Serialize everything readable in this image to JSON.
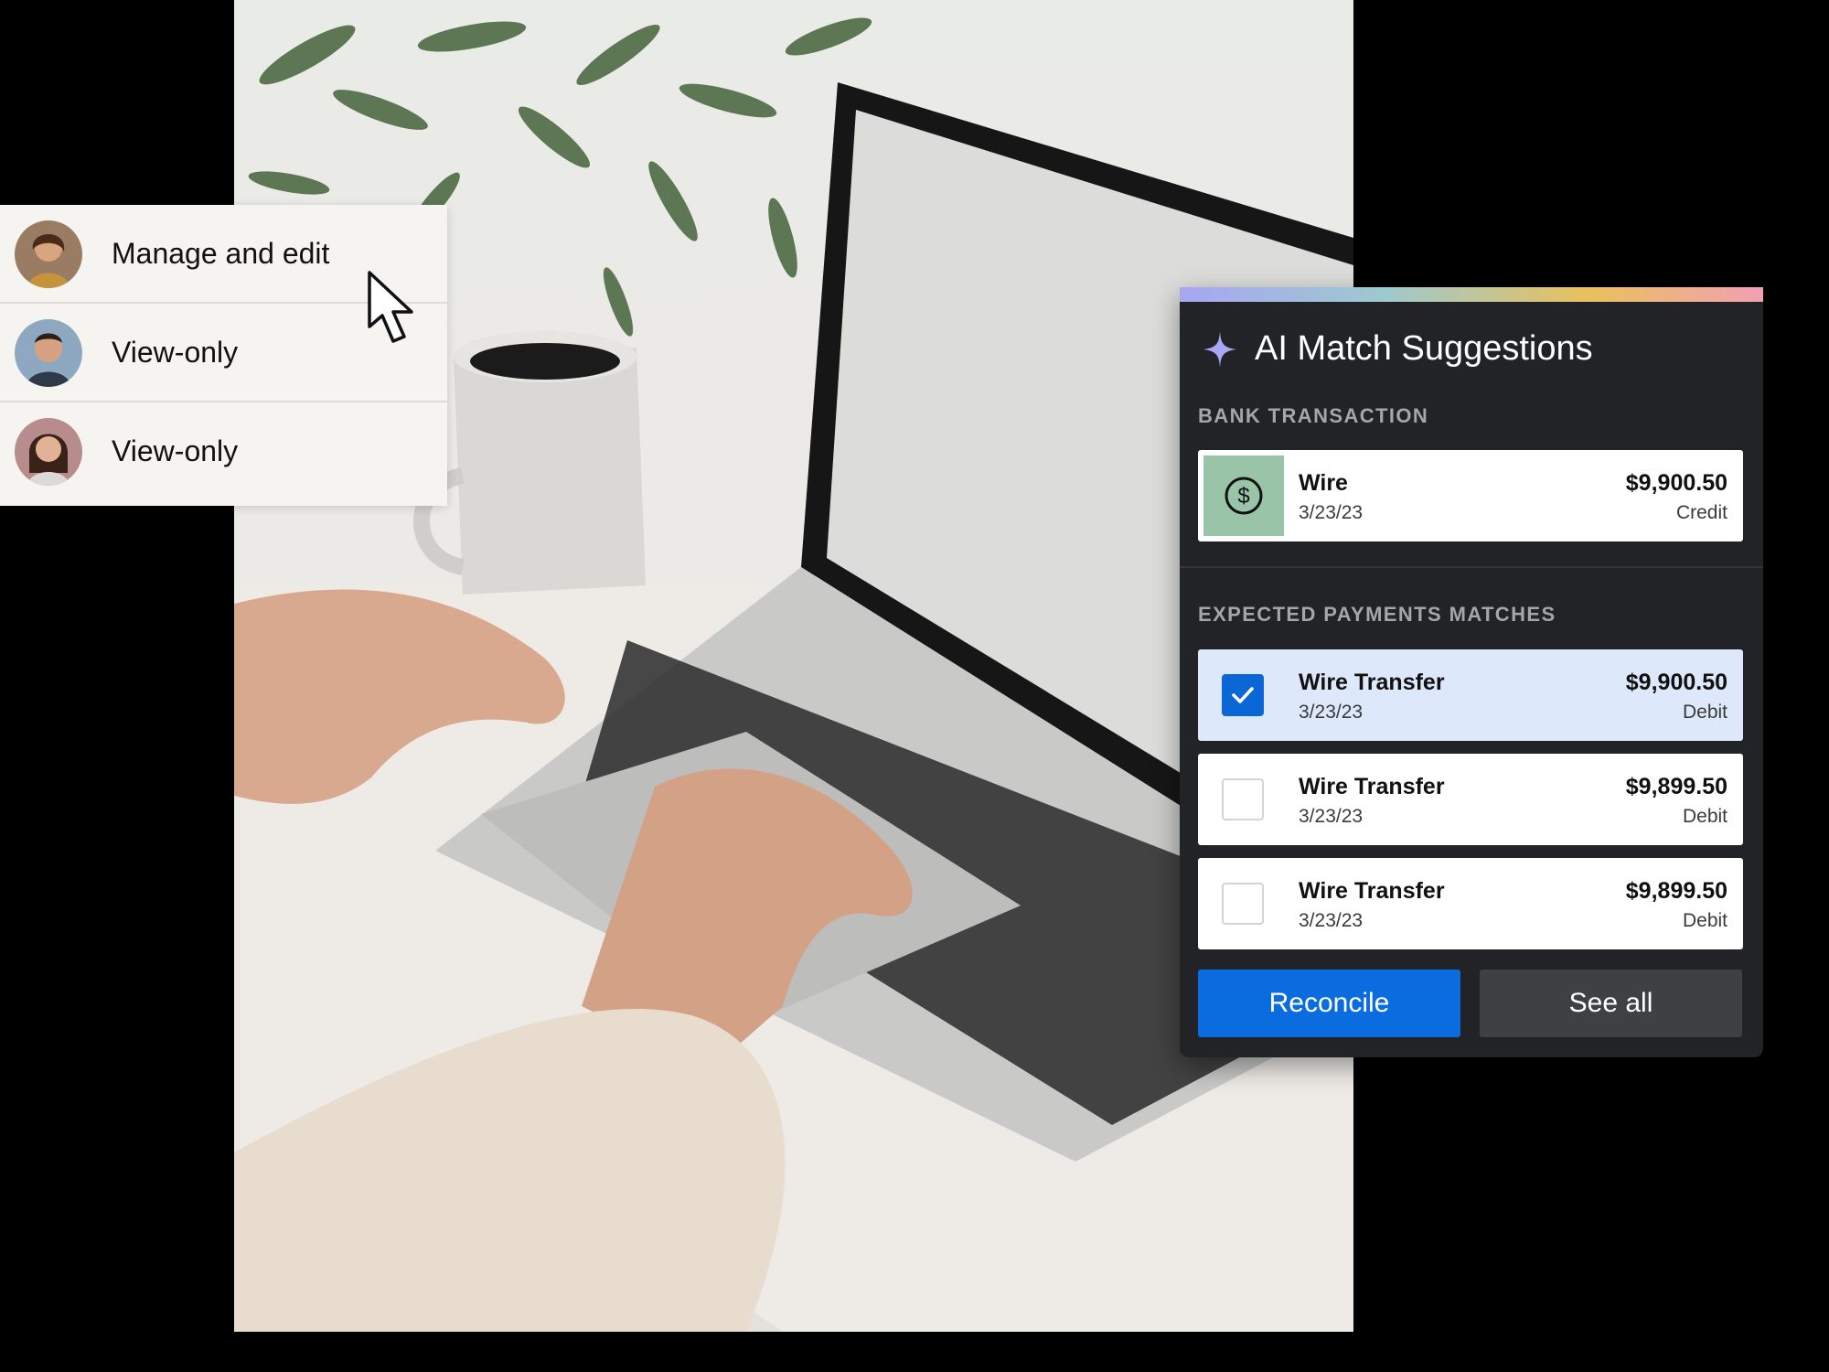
{
  "permissions": {
    "rows": [
      {
        "label": "Manage and edit"
      },
      {
        "label": "View-only"
      },
      {
        "label": "View-only"
      }
    ]
  },
  "ai_panel": {
    "title": "AI Match Suggestions",
    "bank_section_label": "BANK TRANSACTION",
    "bank_transaction": {
      "name": "Wire",
      "date": "3/23/23",
      "amount": "$9,900.50",
      "type": "Credit"
    },
    "matches_section_label": "EXPECTED PAYMENTS MATCHES",
    "matches": [
      {
        "name": "Wire Transfer",
        "date": "3/23/23",
        "amount": "$9,900.50",
        "type": "Debit",
        "checked": true
      },
      {
        "name": "Wire Transfer",
        "date": "3/23/23",
        "amount": "$9,899.50",
        "type": "Debit",
        "checked": false
      },
      {
        "name": "Wire Transfer",
        "date": "3/23/23",
        "amount": "$9,899.50",
        "type": "Debit",
        "checked": false
      }
    ],
    "reconcile_label": "Reconcile",
    "see_all_label": "See all"
  },
  "colors": {
    "accent": "#0b6ce0",
    "panel_bg": "#222326",
    "selected_row": "#dde8fa",
    "dollar_tile": "#9ac4a8"
  }
}
